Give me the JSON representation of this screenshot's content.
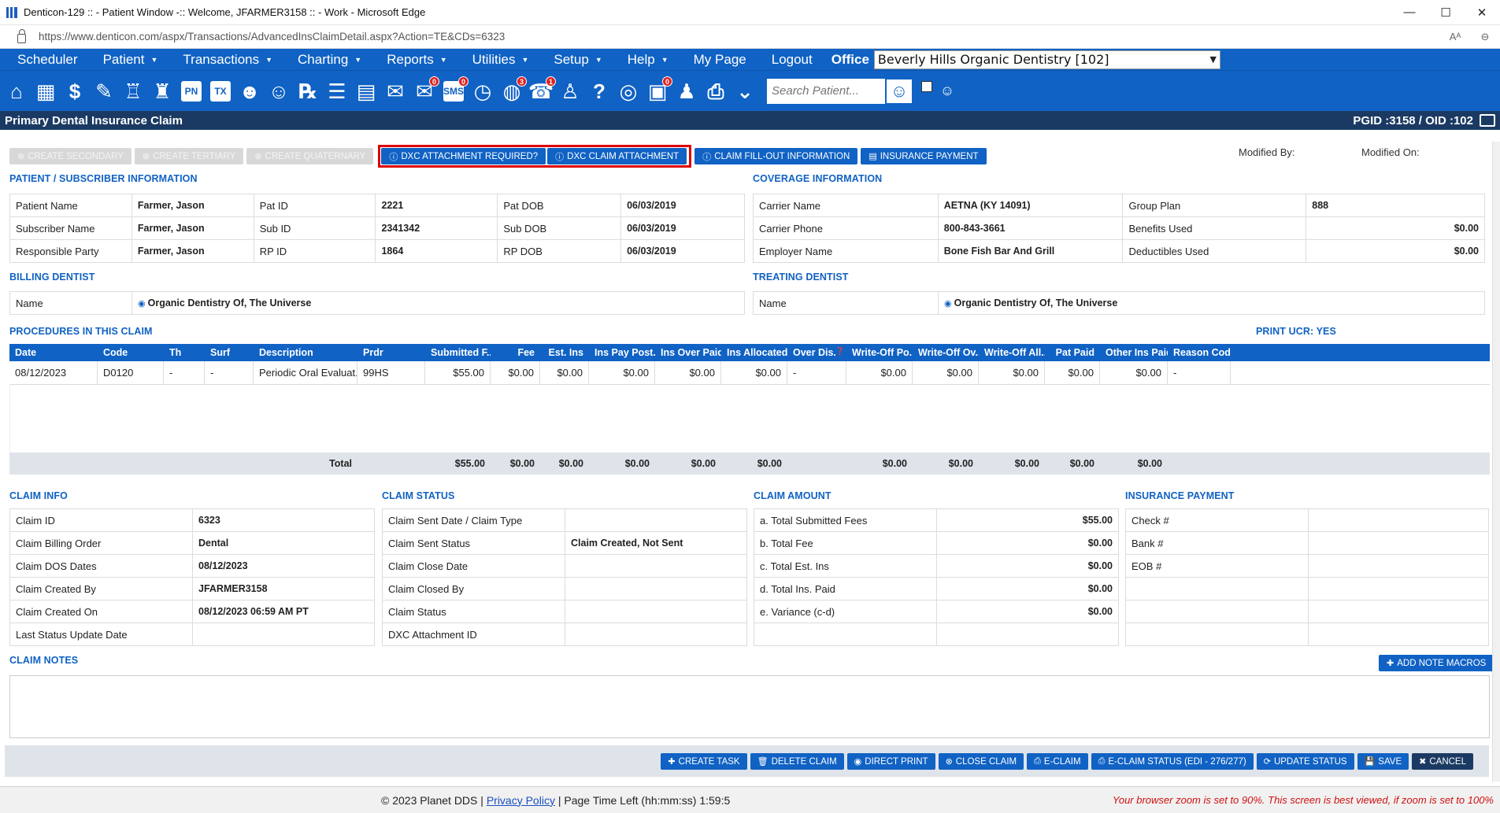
{
  "window": {
    "title": "Denticon-129 :: - Patient Window -:: Welcome, JFARMER3158 :: - Work - Microsoft Edge",
    "url": "https://www.denticon.com/aspx/Transactions/AdvancedInsClaimDetail.aspx?Action=TE&CDs=6323"
  },
  "nav": {
    "items": [
      {
        "label": "Scheduler",
        "caret": false
      },
      {
        "label": "Patient",
        "caret": true
      },
      {
        "label": "Transactions",
        "caret": true
      },
      {
        "label": "Charting",
        "caret": true
      },
      {
        "label": "Reports",
        "caret": true
      },
      {
        "label": "Utilities",
        "caret": true
      },
      {
        "label": "Setup",
        "caret": true
      },
      {
        "label": "Help",
        "caret": true
      },
      {
        "label": "My Page",
        "caret": false
      },
      {
        "label": "Logout",
        "caret": false
      }
    ],
    "office_label": "Office",
    "office_value": "Beverly Hills Organic Dentistry [102]"
  },
  "toolbar": {
    "icons": [
      {
        "name": "home-icon",
        "glyph": "⌂"
      },
      {
        "name": "calendar-icon",
        "glyph": "▦"
      },
      {
        "name": "dollar-icon",
        "glyph": "$"
      },
      {
        "name": "edit-icon",
        "glyph": "✎"
      },
      {
        "name": "tooth-chart-icon",
        "glyph": "♖"
      },
      {
        "name": "tooth-icon",
        "glyph": "♜"
      },
      {
        "name": "pn-icon",
        "text": "PN"
      },
      {
        "name": "tx-icon",
        "text": "TX"
      },
      {
        "name": "add-patient-icon",
        "glyph": "☻"
      },
      {
        "name": "family-icon",
        "glyph": "☺"
      },
      {
        "name": "rx-icon",
        "glyph": "℞"
      },
      {
        "name": "notes-icon",
        "glyph": "☰"
      },
      {
        "name": "scanner-icon",
        "glyph": "▤"
      },
      {
        "name": "mail-icon",
        "glyph": "✉"
      },
      {
        "name": "message-icon",
        "glyph": "✉",
        "badge": "0"
      },
      {
        "name": "sms-icon",
        "text": "SMS",
        "badge": "0"
      },
      {
        "name": "clock-icon",
        "glyph": "◷"
      },
      {
        "name": "globe-icon",
        "glyph": "◍",
        "badge": "3"
      },
      {
        "name": "support-icon",
        "glyph": "☎",
        "badge": "1"
      },
      {
        "name": "tooth-outline-icon",
        "glyph": "♙"
      },
      {
        "name": "tooth-help-icon",
        "glyph": "?"
      },
      {
        "name": "web-icon",
        "glyph": "◎"
      },
      {
        "name": "form-icon",
        "glyph": "▣",
        "badge": "0"
      },
      {
        "name": "group-icon",
        "glyph": "♟"
      },
      {
        "name": "print-icon",
        "glyph": "⎙"
      },
      {
        "name": "chevron-down-box-icon",
        "glyph": "⌄"
      }
    ],
    "search_placeholder": "Search Patient..."
  },
  "claim_header": {
    "title": "Primary Dental Insurance Claim",
    "pgid": "PGID :3158  /  OID :102"
  },
  "top_buttons": {
    "create_secondary": "CREATE SECONDARY",
    "create_tertiary": "CREATE TERTIARY",
    "create_quaternary": "CREATE QUATERNARY",
    "dxc_attachment_required": "DXC ATTACHMENT REQUIRED?",
    "dxc_claim_attachment": "DXC CLAIM ATTACHMENT",
    "claim_fillout": "CLAIM FILL-OUT INFORMATION",
    "insurance_payment": "INSURANCE PAYMENT",
    "modified_by": "Modified By:",
    "modified_on": "Modified On:"
  },
  "patient_info": {
    "title": "PATIENT / SUBSCRIBER INFORMATION",
    "rows": [
      [
        "Patient Name",
        "Farmer, Jason",
        "Pat ID",
        "2221",
        "Pat DOB",
        "06/03/2019"
      ],
      [
        "Subscriber Name",
        "Farmer, Jason",
        "Sub ID",
        "2341342",
        "Sub DOB",
        "06/03/2019"
      ],
      [
        "Responsible Party",
        "Farmer, Jason",
        "RP ID",
        "1864",
        "RP DOB",
        "06/03/2019"
      ]
    ]
  },
  "coverage_info": {
    "title": "COVERAGE INFORMATION",
    "rows": [
      [
        "Carrier Name",
        "AETNA (KY 14091)",
        "Group Plan",
        "888"
      ],
      [
        "Carrier Phone",
        "800-843-3661",
        "Benefits Used",
        "$0.00"
      ],
      [
        "Employer Name",
        "Bone Fish Bar And Grill",
        "Deductibles Used",
        "$0.00"
      ]
    ]
  },
  "billing_dentist": {
    "title": "BILLING DENTIST",
    "label": "Name",
    "value": "Organic Dentistry Of, The Universe"
  },
  "treating_dentist": {
    "title": "TREATING DENTIST",
    "label": "Name",
    "value": "Organic Dentistry Of, The Universe"
  },
  "procedures": {
    "title": "PROCEDURES IN THIS CLAIM",
    "print_ucr": "PRINT UCR: YES",
    "columns": [
      "Date",
      "Code",
      "Th",
      "Surf",
      "Description",
      "Prdr",
      "Submitted F...",
      "Fee",
      "Est. Ins",
      "Ins Pay Post...",
      "Ins Over Paid",
      "Ins Allocated",
      "Over Dis.",
      "Write-Off Po...",
      "Write-Off Ov...",
      "Write-Off All...",
      "Pat Paid",
      "Other Ins Paid",
      "Reason Code"
    ],
    "rows": [
      [
        "08/12/2023",
        "D0120",
        "-",
        "-",
        "Periodic Oral Evaluat...",
        "99HS",
        "$55.00",
        "$0.00",
        "$0.00",
        "$0.00",
        "$0.00",
        "$0.00",
        "-",
        "$0.00",
        "$0.00",
        "$0.00",
        "$0.00",
        "$0.00",
        "-"
      ]
    ],
    "total": [
      "",
      "",
      "",
      "",
      "Total",
      "",
      "$55.00",
      "$0.00",
      "$0.00",
      "$0.00",
      "$0.00",
      "$0.00",
      "",
      "$0.00",
      "$0.00",
      "$0.00",
      "$0.00",
      "$0.00",
      ""
    ]
  },
  "claim_info": {
    "title": "CLAIM INFO",
    "rows": [
      [
        "Claim ID",
        "6323"
      ],
      [
        "Claim Billing Order",
        "Dental"
      ],
      [
        "Claim DOS Dates",
        "08/12/2023"
      ],
      [
        "Claim Created By",
        "JFARMER3158"
      ],
      [
        "Claim Created On",
        "08/12/2023 06:59 AM PT"
      ],
      [
        "Last Status Update Date",
        ""
      ]
    ]
  },
  "claim_status": {
    "title": "CLAIM STATUS",
    "rows": [
      [
        "Claim Sent Date / Claim Type",
        ""
      ],
      [
        "Claim Sent Status",
        "Claim Created, Not Sent"
      ],
      [
        "Claim Close Date",
        ""
      ],
      [
        "Claim Closed By",
        ""
      ],
      [
        "Claim Status",
        ""
      ],
      [
        "DXC Attachment ID",
        ""
      ]
    ]
  },
  "claim_amount": {
    "title": "CLAIM AMOUNT",
    "rows": [
      [
        "a. Total Submitted Fees",
        "$55.00"
      ],
      [
        "b. Total Fee",
        "$0.00"
      ],
      [
        "c. Total Est. Ins",
        "$0.00"
      ],
      [
        "d. Total Ins. Paid",
        "$0.00"
      ],
      [
        "e. Variance (c-d)",
        "$0.00"
      ],
      [
        "",
        ""
      ]
    ]
  },
  "insurance_payment": {
    "title": "INSURANCE PAYMENT",
    "rows": [
      [
        "Check #",
        ""
      ],
      [
        "Bank #",
        ""
      ],
      [
        "EOB #",
        ""
      ],
      [
        "",
        ""
      ],
      [
        "",
        ""
      ],
      [
        "",
        ""
      ]
    ]
  },
  "claim_notes": {
    "title": "CLAIM NOTES",
    "add_macros": "ADD NOTE MACROS"
  },
  "bottom_buttons": {
    "create_task": "CREATE TASK",
    "delete_claim": "DELETE CLAIM",
    "direct_print": "DIRECT PRINT",
    "close_claim": "CLOSE CLAIM",
    "e_claim": "E-CLAIM",
    "e_claim_status": "E-CLAIM STATUS (EDI - 276/277)",
    "update_status": "UPDATE STATUS",
    "save": "SAVE",
    "cancel": "CANCEL"
  },
  "footer": {
    "copyright": "© 2023 Planet DDS |",
    "privacy": "Privacy Policy",
    "page_time": "| Page Time Left (hh:mm:ss) 1:59:5",
    "zoom_warning": "Your browser zoom is set to 90%. This screen is best viewed, if zoom is set to 100%"
  }
}
